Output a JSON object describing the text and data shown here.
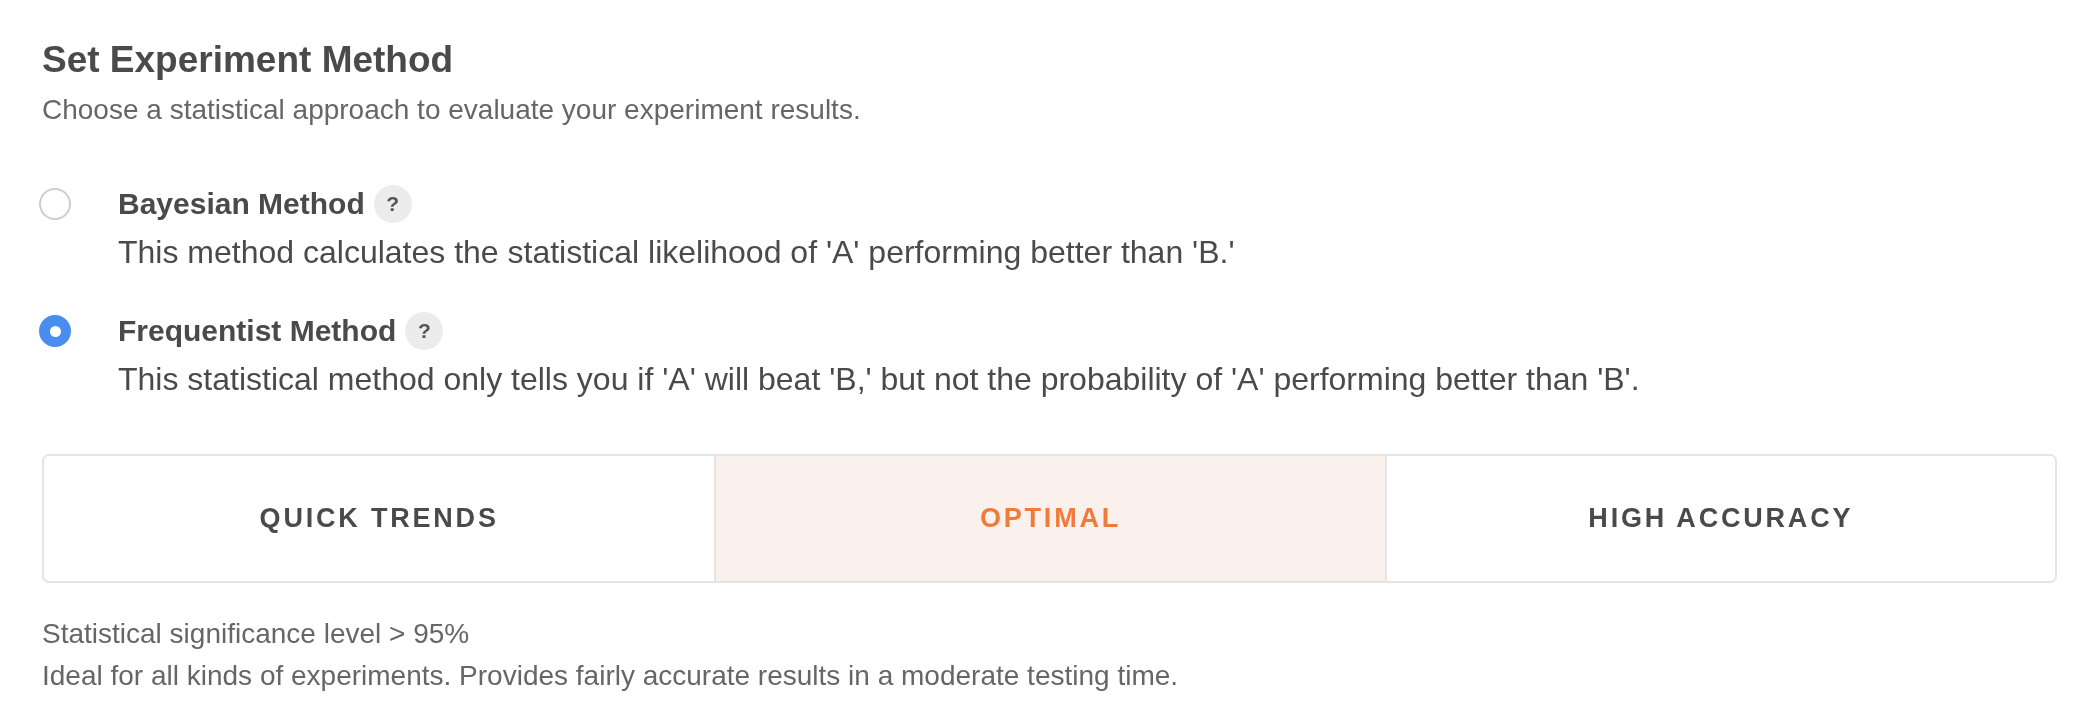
{
  "header": {
    "title": "Set Experiment Method",
    "subtitle": "Choose a statistical approach to evaluate your experiment results."
  },
  "methods": [
    {
      "label": "Bayesian Method",
      "help": "?",
      "description": "This method calculates the statistical likelihood of 'A' performing better than 'B.'",
      "selected": false
    },
    {
      "label": "Frequentist Method",
      "help": "?",
      "description": "This statistical method only tells you if 'A' will beat 'B,' but not the probability of 'A' performing better than 'B'.",
      "selected": true
    }
  ],
  "presets": [
    {
      "label": "QUICK TRENDS",
      "selected": false
    },
    {
      "label": "OPTIMAL",
      "selected": true
    },
    {
      "label": "HIGH ACCURACY",
      "selected": false
    }
  ],
  "summary": [
    "Statistical significance level > 95%",
    "Ideal for all kinds of experiments. Provides fairly accurate results in a moderate testing time."
  ]
}
